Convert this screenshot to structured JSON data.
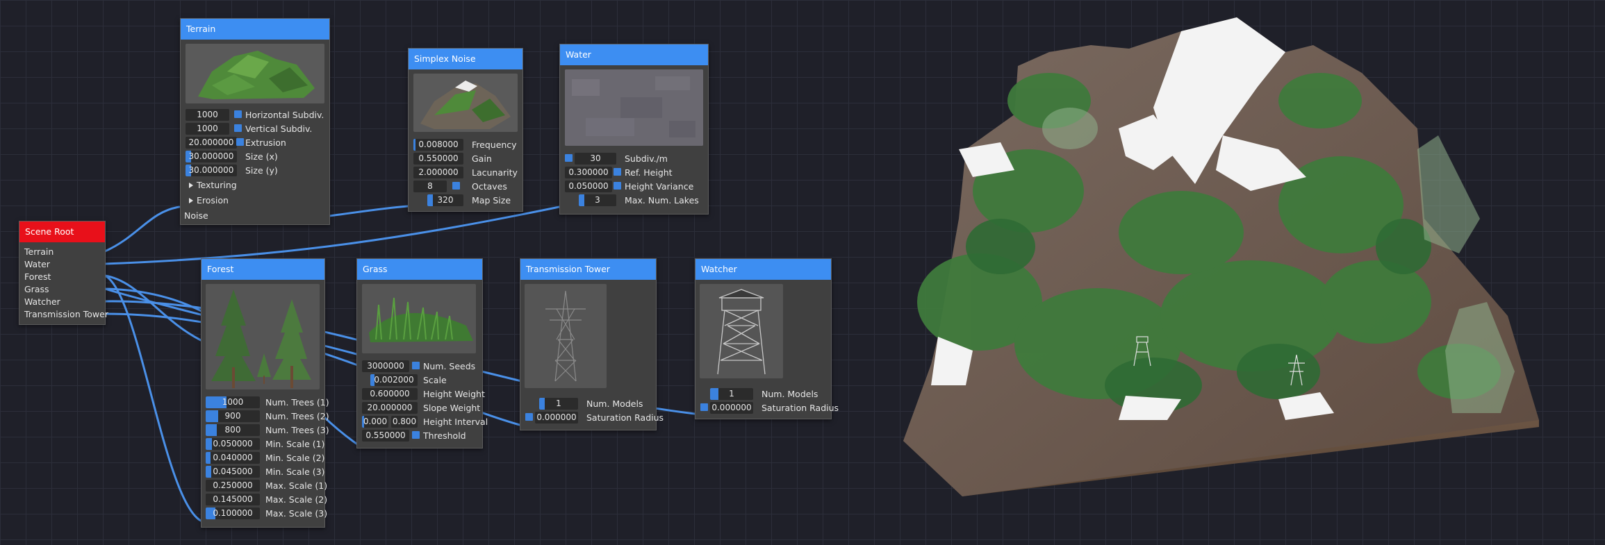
{
  "nodes": {
    "scene_root": {
      "title": "Scene Root",
      "outputs": [
        "Terrain",
        "Water",
        "Forest",
        "Grass",
        "Watcher",
        "Transmission Tower"
      ]
    },
    "terrain": {
      "title": "Terrain",
      "params": [
        {
          "value": "1000",
          "label": "Horizontal Subdiv."
        },
        {
          "value": "1000",
          "label": "Vertical Subdiv."
        },
        {
          "value": "20.000000",
          "label": "Extrusion"
        },
        {
          "value": "30.000000",
          "label": "Size (x)"
        },
        {
          "value": "30.000000",
          "label": "Size (y)"
        }
      ],
      "sections": [
        "Texturing",
        "Erosion"
      ],
      "input_label": "Noise"
    },
    "simplex": {
      "title": "Simplex Noise",
      "params": [
        {
          "value": "0.008000",
          "label": "Frequency"
        },
        {
          "value": "0.550000",
          "label": "Gain"
        },
        {
          "value": "2.000000",
          "label": "Lacunarity"
        },
        {
          "value": "8",
          "label": "Octaves"
        },
        {
          "value": "320",
          "label": "Map Size"
        }
      ]
    },
    "water": {
      "title": "Water",
      "params": [
        {
          "value": "30",
          "label": "Subdiv./m"
        },
        {
          "value": "0.300000",
          "label": "Ref. Height"
        },
        {
          "value": "0.050000",
          "label": "Height Variance"
        },
        {
          "value": "3",
          "label": "Max. Num. Lakes"
        }
      ]
    },
    "forest": {
      "title": "Forest",
      "params": [
        {
          "value": "1000",
          "label": "Num. Trees (1)"
        },
        {
          "value": "900",
          "label": "Num. Trees (2)"
        },
        {
          "value": "800",
          "label": "Num. Trees (3)"
        },
        {
          "value": "0.050000",
          "label": "Min. Scale (1)"
        },
        {
          "value": "0.040000",
          "label": "Min. Scale (2)"
        },
        {
          "value": "0.045000",
          "label": "Min. Scale (3)"
        },
        {
          "value": "0.250000",
          "label": "Max. Scale (1)"
        },
        {
          "value": "0.145000",
          "label": "Max. Scale (2)"
        },
        {
          "value": "0.100000",
          "label": "Max. Scale (3)"
        }
      ]
    },
    "grass": {
      "title": "Grass",
      "params": [
        {
          "value": "3000000",
          "label": "Num. Seeds"
        },
        {
          "value": "0.002000",
          "label": "Scale"
        },
        {
          "value": "0.600000",
          "label": "Height Weight"
        },
        {
          "value": "20.000000",
          "label": "Slope Weight"
        },
        {
          "value": "0.000",
          "value2": "0.800",
          "label": "Height Interval"
        },
        {
          "value": "0.550000",
          "label": "Threshold"
        }
      ]
    },
    "tower": {
      "title": "Transmission Tower",
      "params": [
        {
          "value": "1",
          "label": "Num. Models"
        },
        {
          "value": "0.000000",
          "label": "Saturation Radius"
        }
      ]
    },
    "watcher": {
      "title": "Watcher",
      "params": [
        {
          "value": "1",
          "label": "Num. Models"
        },
        {
          "value": "0.000000",
          "label": "Saturation Radius"
        }
      ]
    }
  },
  "colors": {
    "accent": "#3d8ef2",
    "root_header": "#e8101a",
    "wire": "#4a90e8",
    "background": "#1f2029"
  }
}
